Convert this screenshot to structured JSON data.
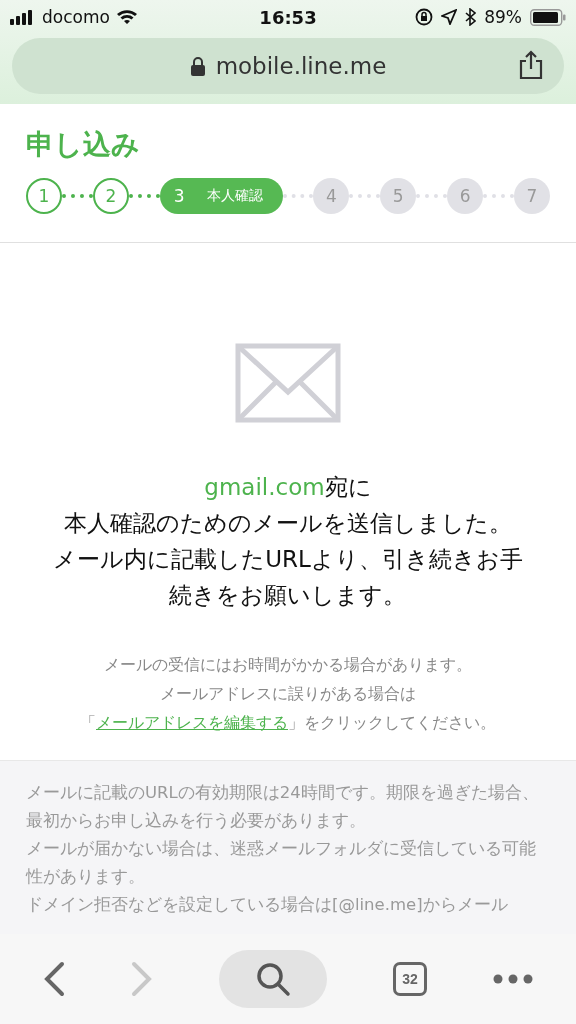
{
  "status_bar": {
    "carrier": "docomo",
    "time": "16:53",
    "battery": "89%"
  },
  "address_bar": {
    "url": "mobile.line.me"
  },
  "header": {
    "title": "申し込み"
  },
  "steps": [
    {
      "number": "1",
      "done": true,
      "selected": false
    },
    {
      "number": "2",
      "done": true,
      "selected": false
    },
    {
      "number": "3",
      "label": "本人確認",
      "done": false,
      "selected": true
    },
    {
      "number": "4",
      "done": false,
      "selected": false
    },
    {
      "number": "5",
      "done": false,
      "selected": false
    },
    {
      "number": "6",
      "done": false,
      "selected": false
    },
    {
      "number": "7",
      "done": false,
      "selected": false
    }
  ],
  "message": {
    "email_domain": "gmail.com",
    "email_suffix": "宛に",
    "lines": [
      "本人確認のためのメールを送信しました。",
      "メール内に記載したURLより、引き続きお手",
      "続きをお願いします。"
    ]
  },
  "notes": {
    "lines": [
      "メールの受信にはお時間がかかる場合があります。",
      "メールアドレスに誤りがある場合は"
    ],
    "link_prefix": "「",
    "link": "メールアドレスを編集する",
    "link_suffix": "」をクリックしてください。"
  },
  "info": {
    "paragraphs": [
      "メールに記載のURLの有効期限は24時間です。期限を過ぎた場合、最初からお申し込みを行う必要があります。",
      "メールが届かない場合は、迷惑メールフォルダに受信している可能性があります。",
      "ドメイン拒否などを設定している場合は[@line.me]からメール"
    ]
  },
  "toolbar": {
    "tabs_count": "32"
  }
}
